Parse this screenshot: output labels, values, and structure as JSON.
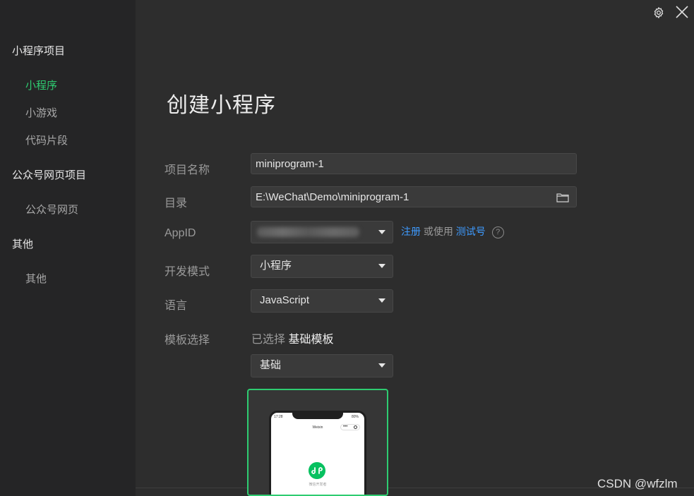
{
  "sidebar": {
    "sections": [
      {
        "title": "小程序项目",
        "items": [
          "小程序",
          "小游戏",
          "代码片段"
        ]
      },
      {
        "title": "公众号网页项目",
        "items": [
          "公众号网页"
        ]
      },
      {
        "title": "其他",
        "items": [
          "其他"
        ]
      }
    ],
    "active_item": "小程序"
  },
  "main": {
    "title": "创建小程序",
    "form": {
      "project_name": {
        "label": "项目名称",
        "value": "miniprogram-1"
      },
      "directory": {
        "label": "目录",
        "value": "E:\\WeChat\\Demo\\miniprogram-1",
        "icon": "folder-icon"
      },
      "appid": {
        "label": "AppID",
        "register_link": "注册",
        "or_use_text": "或使用",
        "test_id_link": "测试号",
        "help_icon": "?"
      },
      "dev_mode": {
        "label": "开发模式",
        "value": "小程序"
      },
      "language": {
        "label": "语言",
        "value": "JavaScript"
      },
      "template": {
        "label": "模板选择",
        "selected_prefix": "已选择",
        "selected_name": "基础模板",
        "category_value": "基础"
      }
    },
    "template_preview": {
      "time": "17:28",
      "battery": "80%",
      "app_title": "Weixin",
      "capsule_dots": "•••",
      "caption": "微信开发者"
    }
  },
  "window": {
    "settings_icon": "gear-icon",
    "close_icon": "close-icon"
  },
  "watermark": "CSDN @wfzlm",
  "colors": {
    "accent": "#2ecc71",
    "link": "#3e9bff",
    "sidebar_bg": "#252526",
    "main_bg": "#2d2d2d"
  }
}
